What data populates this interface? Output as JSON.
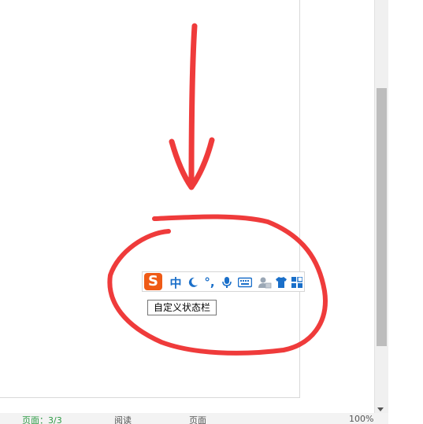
{
  "status_bar": {
    "word_count": "页面：3/3",
    "reading_label": "阅读",
    "view_label": "页面",
    "zoom": "100%"
  },
  "ime_toolbar": {
    "logo": "S",
    "language": "中",
    "punctuation": "°,",
    "icons": [
      "sogou-logo-icon",
      "moon-icon",
      "microphone-icon",
      "keyboard-icon",
      "user-icon",
      "skin-shirt-icon",
      "toolbox-icon"
    ],
    "accent_color": "#1a6fc9",
    "logo_color": "#ef5a16"
  },
  "tooltip": {
    "text": "自定义状态栏"
  },
  "annotation": {
    "color": "#ef3b3b"
  }
}
